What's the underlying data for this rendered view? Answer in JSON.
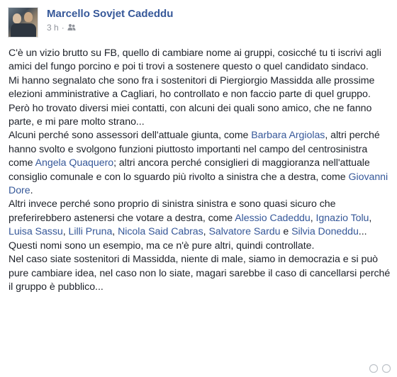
{
  "post": {
    "author": "Marcello Sovjet Cadeddu",
    "time": "3 h",
    "separator": "·",
    "audience_icon": "group-icon",
    "paragraphs": [
      [
        {
          "t": "C'è un vizio brutto su FB, quello di cambiare nome ai gruppi, cosicché tu ti iscrivi agli amici del fungo porcino e poi ti trovi a sostenere questo o quel candidato sindaco."
        }
      ],
      [
        {
          "t": "Mi hanno segnalato che sono fra i sostenitori di Piergiorgio Massidda alle prossime elezioni amministrative a Cagliari, ho controllato e non faccio parte di quel gruppo."
        }
      ],
      [
        {
          "t": "Però ho trovato diversi miei contatti, con alcuni dei quali sono amico, che ne fanno parte, e mi pare molto strano..."
        }
      ],
      [
        {
          "t": "Alcuni perché sono assessori dell'attuale giunta, come "
        },
        {
          "t": "Barbara Argiolas",
          "link": true
        },
        {
          "t": ", altri perché hanno svolto e svolgono funzioni piuttosto importanti nel campo del centrosinistra come "
        },
        {
          "t": "Angela Quaquero",
          "link": true
        },
        {
          "t": "; altri ancora perché consiglieri di maggioranza nell'attuale consiglio comunale e con lo sguardo più rivolto a sinistra che a destra, come "
        },
        {
          "t": "Giovanni Dore",
          "link": true
        },
        {
          "t": "."
        }
      ],
      [
        {
          "t": "Altri invece perché sono proprio di sinistra sinistra e sono quasi sicuro che preferirebbero astenersi che votare a destra, come "
        },
        {
          "t": "Alessio Cadeddu",
          "link": true
        },
        {
          "t": ", "
        },
        {
          "t": "Ignazio Tolu",
          "link": true
        },
        {
          "t": ", "
        },
        {
          "t": "Luisa Sassu",
          "link": true
        },
        {
          "t": ", "
        },
        {
          "t": "Lilli Pruna",
          "link": true
        },
        {
          "t": ", "
        },
        {
          "t": "Nicola Said Cabras",
          "link": true
        },
        {
          "t": ", "
        },
        {
          "t": "Salvatore Sardu",
          "link": true
        },
        {
          "t": " e "
        },
        {
          "t": "Silvia Doneddu",
          "link": true
        },
        {
          "t": "..."
        }
      ],
      [
        {
          "t": "Questi nomi sono un esempio, ma ce n'è pure altri, quindi controllate."
        }
      ],
      [
        {
          "t": "Nel caso siate sostenitori di Massidda, niente di male, siamo in democrazia e si può pure cambiare idea, nel caso non lo siate, magari sarebbe il caso di cancellarsi perché il gruppo è pubblico..."
        }
      ]
    ]
  }
}
